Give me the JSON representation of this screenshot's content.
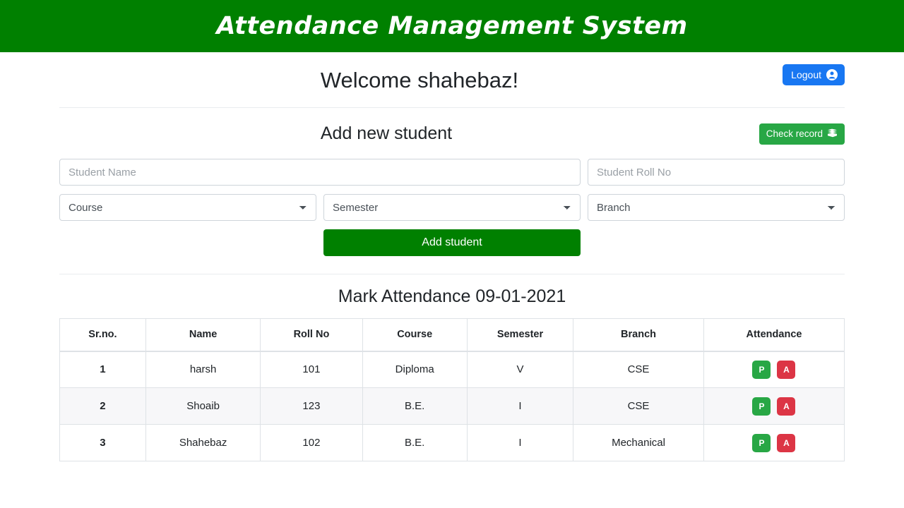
{
  "header": {
    "app_title": "Attendance Management System",
    "background_color": "#008000"
  },
  "welcome": {
    "greeting": "Welcome shahebaz!",
    "logout_label": "Logout",
    "logout_icon": "user-circle-icon",
    "logout_color": "#1877f2"
  },
  "add_student": {
    "section_title": "Add new student",
    "check_record_label": "Check record",
    "check_record_icon": "book-icon",
    "check_record_color": "#28a745",
    "fields": {
      "student_name_placeholder": "Student Name",
      "student_name_value": "",
      "student_roll_placeholder": "Student Roll No",
      "student_roll_value": "",
      "course_selected": "Course",
      "semester_selected": "Semester",
      "branch_selected": "Branch"
    },
    "submit_label": "Add student",
    "submit_color": "#008000"
  },
  "attendance": {
    "title": "Mark Attendance 09-01-2021",
    "date": "09-01-2021",
    "columns": [
      "Sr.no.",
      "Name",
      "Roll No",
      "Course",
      "Semester",
      "Branch",
      "Attendance"
    ],
    "present_label": "P",
    "absent_label": "A",
    "present_color": "#28a745",
    "absent_color": "#dc3545",
    "rows": [
      {
        "sr": "1",
        "name": "harsh",
        "roll": "101",
        "course": "Diploma",
        "semester": "V",
        "branch": "CSE"
      },
      {
        "sr": "2",
        "name": "Shoaib",
        "roll": "123",
        "course": "B.E.",
        "semester": "I",
        "branch": "CSE"
      },
      {
        "sr": "3",
        "name": "Shahebaz",
        "roll": "102",
        "course": "B.E.",
        "semester": "I",
        "branch": "Mechanical"
      }
    ]
  }
}
